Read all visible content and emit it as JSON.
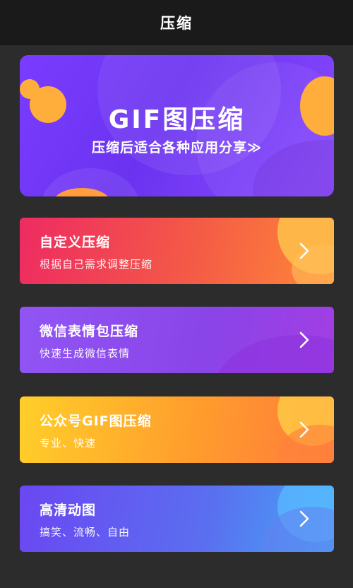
{
  "header": {
    "title": "压缩"
  },
  "hero": {
    "title": "GIF图压缩",
    "subtitle": "压缩后适合各种应用分享≫"
  },
  "cards": [
    {
      "title": "自定义压缩",
      "subtitle": "根据自己需求调整压缩",
      "icon": "chevron-right-icon"
    },
    {
      "title": "微信表情包压缩",
      "subtitle": "快速生成微信表情",
      "icon": "chevron-right-icon"
    },
    {
      "title": "公众号GIF图压缩",
      "subtitle": "专业、快速",
      "icon": "chevron-right-icon"
    },
    {
      "title": "高清动图",
      "subtitle": "搞笑、流畅、自由",
      "icon": "chevron-right-icon"
    }
  ],
  "colors": {
    "topbar": "#1a1a1a",
    "background": "#2c2c2c",
    "hero_purple": "#7a3cff",
    "accent_orange": "#ffad3b",
    "card_red": "#ee2b62",
    "card_purple": "#9155f4",
    "card_yellow": "#ffcf2a",
    "card_blue": "#5a6ff0"
  }
}
